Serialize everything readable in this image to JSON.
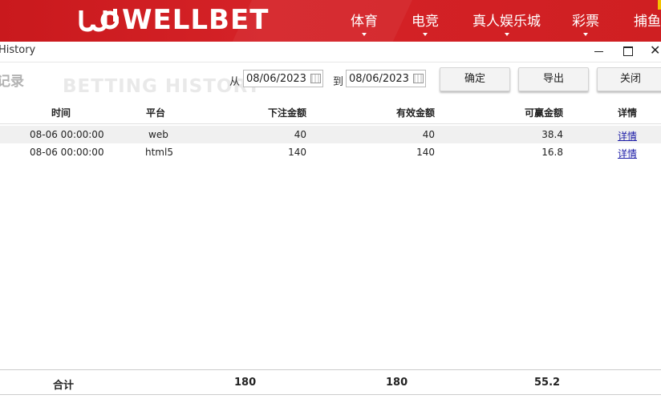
{
  "header": {
    "logo_text": "WELLBET",
    "nav": [
      {
        "label": "体育"
      },
      {
        "label": "电竞"
      },
      {
        "label": "真人娱乐城"
      },
      {
        "label": "彩票"
      },
      {
        "label": "捕鱼"
      }
    ],
    "brand_color": "#d0201f"
  },
  "window": {
    "title": "History"
  },
  "toolbar": {
    "page_title": "记录",
    "watermark": "BETTING HISTORY",
    "from_label": "从",
    "from_date": "08/06/2023",
    "to_label": "到",
    "to_date": "08/06/2023",
    "confirm_label": "确定",
    "export_label": "导出",
    "close_label": "关闭"
  },
  "table": {
    "columns": [
      "时间",
      "平台",
      "下注金额",
      "有效金额",
      "可赢金额",
      "详情"
    ],
    "rows": [
      {
        "time": "08-06 00:00:00",
        "platform": "web",
        "bet": "40",
        "valid": "40",
        "win": "38.4",
        "detail": "详情"
      },
      {
        "time": "08-06 00:00:00",
        "platform": "html5",
        "bet": "140",
        "valid": "140",
        "win": "16.8",
        "detail": "详情"
      }
    ],
    "footer": {
      "label": "合计",
      "bet_total": "180",
      "valid_total": "180",
      "win_total": "55.2"
    }
  }
}
